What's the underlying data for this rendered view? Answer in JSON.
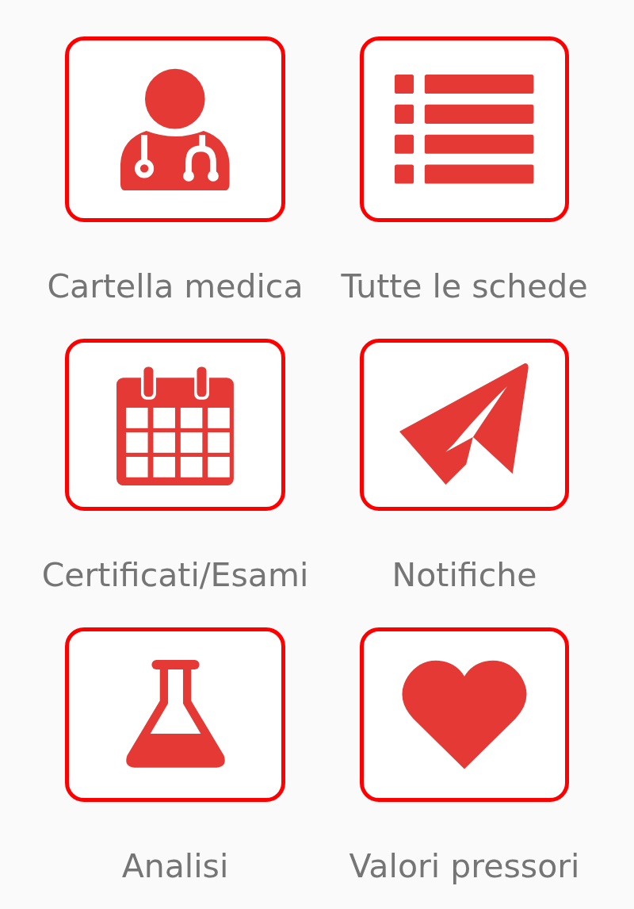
{
  "tiles": [
    {
      "kind": "doctor",
      "label": "Cartella medica"
    },
    {
      "kind": "list",
      "label": "Tutte le schede"
    },
    {
      "kind": "calendar",
      "label": "Certificati/Esami"
    },
    {
      "kind": "plane",
      "label": "Notifiche"
    },
    {
      "kind": "flask",
      "label": "Analisi"
    },
    {
      "kind": "heart",
      "label": "Valori pressori"
    }
  ]
}
